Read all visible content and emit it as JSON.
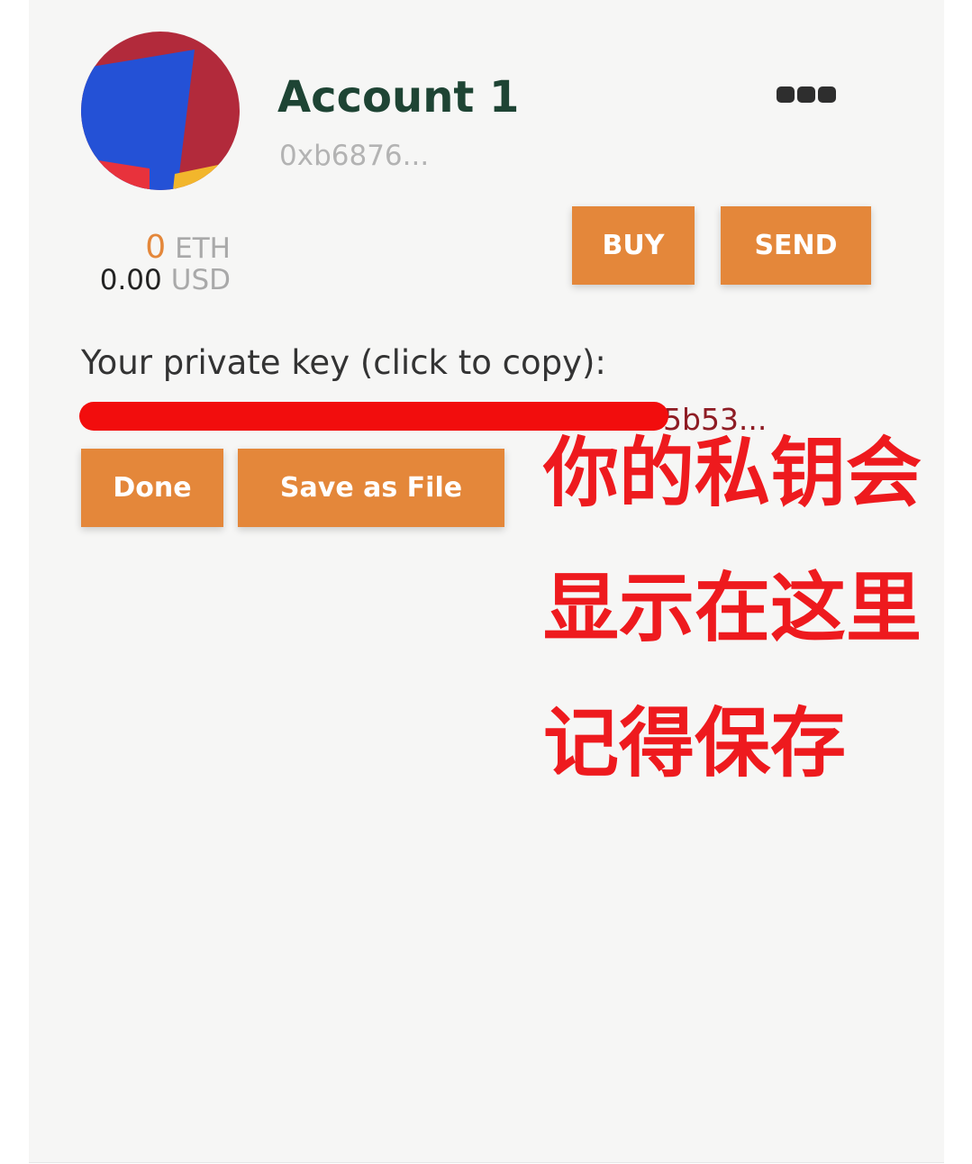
{
  "account": {
    "name": "Account 1",
    "address": "0xb6876...",
    "menu_icon": "ellipsis-icon",
    "avatar_icon": "identicon-avatar"
  },
  "balance": {
    "eth_value": "0",
    "eth_unit": "ETH",
    "usd_value": "0.00",
    "usd_unit": "USD"
  },
  "actions": {
    "buy_label": "BUY",
    "send_label": "SEND"
  },
  "private_key": {
    "label": "Your private key (click to copy):",
    "visible_value": "5b53..."
  },
  "key_actions": {
    "done_label": "Done",
    "save_label": "Save as File"
  },
  "annotation": {
    "lines": [
      "你的私钥会",
      "显示在这里",
      "记得保存"
    ]
  },
  "colors": {
    "accent": "#e4873a",
    "panel": "#f6f6f5",
    "title": "#1e4434",
    "annotation": "#ee1a1e",
    "redaction": "#f20d0d",
    "avatar": [
      "#b22a3b",
      "#2451d6",
      "#e8323c",
      "#f2b62c"
    ]
  }
}
